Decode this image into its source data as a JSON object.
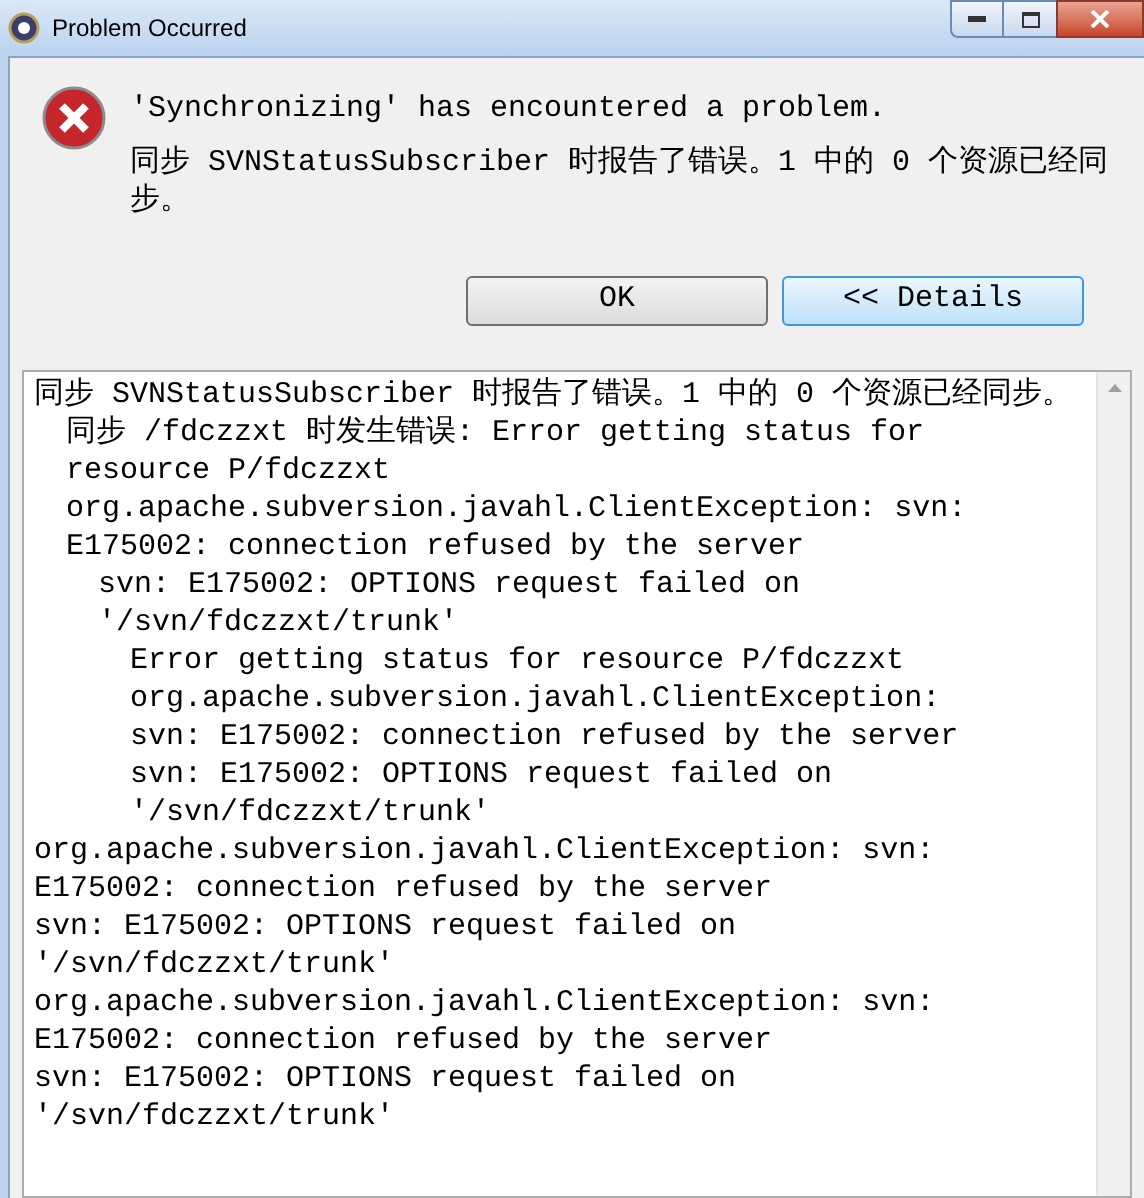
{
  "window": {
    "title": "Problem Occurred"
  },
  "message": {
    "title": "'Synchronizing' has encountered a problem.",
    "body": "同步 SVNStatusSubscriber 时报告了错误。1 中的 0 个资源已经同步。"
  },
  "buttons": [
    {
      "label": "OK",
      "focused": false
    },
    {
      "label": "<< Details",
      "focused": true
    }
  ],
  "details": [
    {
      "text": "同步 SVNStatusSubscriber 时报告了错误。1 中的 0 个资源已经同步。",
      "children": [
        {
          "text": "同步 /fdczzxt 时发生错误: Error getting status for"
        },
        {
          "text": "resource P/fdczzxt"
        },
        {
          "text": "org.apache.subversion.javahl.ClientException: svn:"
        },
        {
          "text": "E175002: connection refused by the server",
          "children": [
            {
              "text": "svn: E175002: OPTIONS request failed on"
            },
            {
              "text": "'/svn/fdczzxt/trunk'",
              "children": [
                {
                  "text": "Error getting status for resource P/fdczzxt"
                },
                {
                  "text": "org.apache.subversion.javahl.ClientException:"
                },
                {
                  "text": "svn: E175002: connection refused by the server"
                },
                {
                  "text": "svn: E175002: OPTIONS request failed on"
                },
                {
                  "text": "'/svn/fdczzxt/trunk'"
                }
              ]
            }
          ]
        }
      ]
    },
    {
      "text": "org.apache.subversion.javahl.ClientException: svn:"
    },
    {
      "text": "E175002: connection refused by the server"
    },
    {
      "text": "svn: E175002: OPTIONS request failed on"
    },
    {
      "text": "'/svn/fdczzxt/trunk'"
    },
    {
      "text": "org.apache.subversion.javahl.ClientException: svn:"
    },
    {
      "text": "E175002: connection refused by the server"
    },
    {
      "text": "svn: E175002: OPTIONS request failed on"
    },
    {
      "text": "'/svn/fdczzxt/trunk'"
    }
  ]
}
